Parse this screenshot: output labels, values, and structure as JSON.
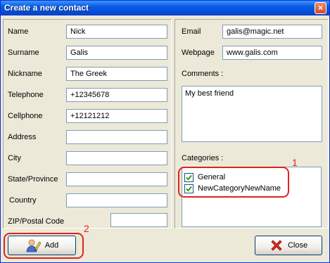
{
  "window": {
    "title": "Create a new contact",
    "close_glyph": "×"
  },
  "left_fields": [
    {
      "label": "Name",
      "value": "Nick"
    },
    {
      "label": "Surname",
      "value": "Galis"
    },
    {
      "label": "Nickname",
      "value": "The Greek"
    },
    {
      "label": "Telephone",
      "value": "+12345678"
    },
    {
      "label": "Cellphone",
      "value": "+12121212"
    },
    {
      "label": "Address",
      "value": ""
    },
    {
      "label": "City",
      "value": ""
    },
    {
      "label": "State/Province",
      "value": ""
    },
    {
      "label": "Country",
      "value": ""
    },
    {
      "label": "ZIP/Postal Code",
      "value": ""
    }
  ],
  "right_fields": {
    "email": {
      "label": "Email",
      "value": "galis@magic.net"
    },
    "webpage": {
      "label": "Webpage",
      "value": "www.galis.com"
    },
    "comments": {
      "label": "Comments :",
      "value": "My best friend"
    }
  },
  "categories": {
    "label": "Categories :",
    "items": [
      {
        "label": "General",
        "checked": true
      },
      {
        "label": "NewCategoryNewName",
        "checked": true
      }
    ]
  },
  "buttons": {
    "add": "Add",
    "close": "Close"
  },
  "annotations": {
    "one": "1",
    "two": "2",
    "color": "#e0231c"
  },
  "icons": {
    "add": "person-pencil-icon",
    "close": "red-x-icon",
    "check": "check-icon"
  }
}
